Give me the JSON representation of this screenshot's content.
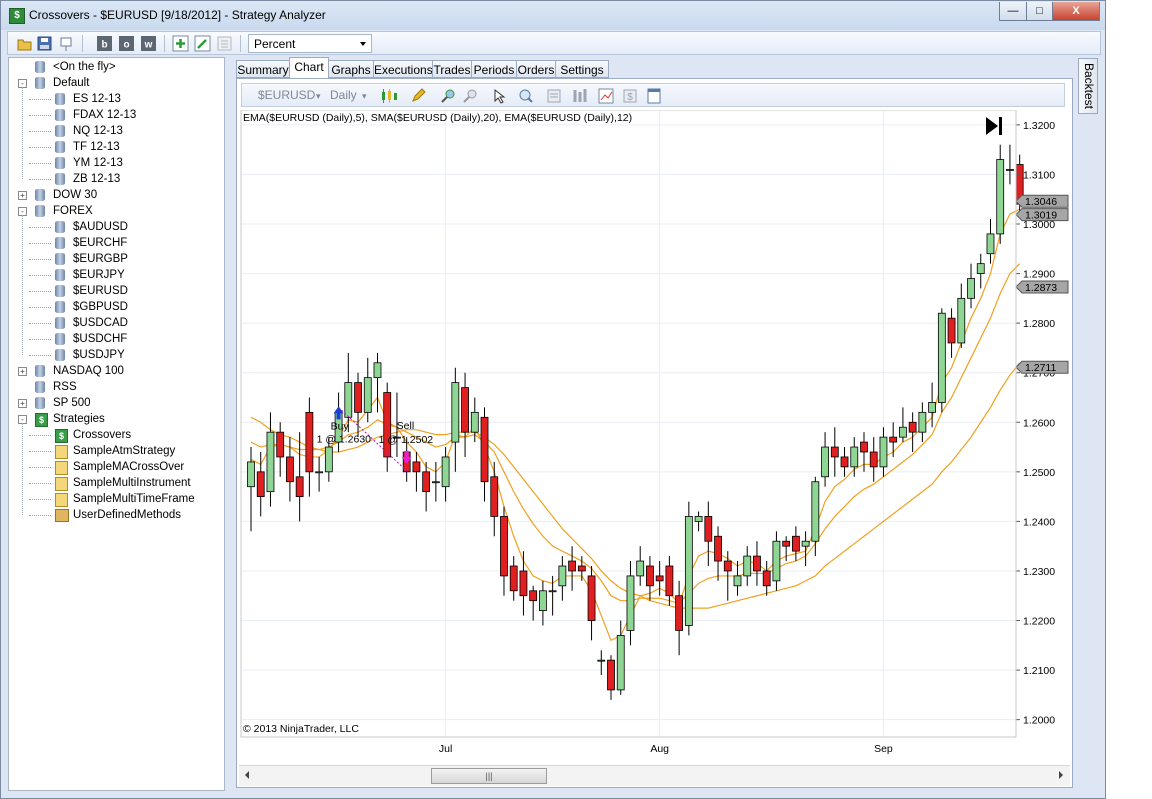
{
  "window": {
    "title": "Crossovers - $EURUSD [9/18/2012] - Strategy Analyzer",
    "icon": "dollar-icon",
    "minimize_label": "—",
    "maximize_label": "□",
    "close_label": "X"
  },
  "toolbar": {
    "icons": [
      "open-folder-icon",
      "save-icon",
      "properties-icon",
      "b-icon",
      "o-icon",
      "w-icon",
      "add-icon",
      "edit-icon",
      "delete-icon"
    ],
    "display_mode": "Percent"
  },
  "tree": {
    "nodes": [
      {
        "label": "<On the fly>",
        "type": "db",
        "level": 0,
        "expander": ""
      },
      {
        "label": "Default",
        "type": "db",
        "level": 0,
        "expander": "-"
      },
      {
        "label": "ES 12-13",
        "type": "db",
        "level": 1,
        "expander": ""
      },
      {
        "label": "FDAX 12-13",
        "type": "db",
        "level": 1,
        "expander": ""
      },
      {
        "label": "NQ 12-13",
        "type": "db",
        "level": 1,
        "expander": ""
      },
      {
        "label": "TF 12-13",
        "type": "db",
        "level": 1,
        "expander": ""
      },
      {
        "label": "YM 12-13",
        "type": "db",
        "level": 1,
        "expander": ""
      },
      {
        "label": "ZB 12-13",
        "type": "db",
        "level": 1,
        "expander": ""
      },
      {
        "label": "DOW 30",
        "type": "db",
        "level": 0,
        "expander": "+"
      },
      {
        "label": "FOREX",
        "type": "db",
        "level": 0,
        "expander": "-"
      },
      {
        "label": "$AUDUSD",
        "type": "db",
        "level": 1,
        "expander": ""
      },
      {
        "label": "$EURCHF",
        "type": "db",
        "level": 1,
        "expander": ""
      },
      {
        "label": "$EURGBP",
        "type": "db",
        "level": 1,
        "expander": ""
      },
      {
        "label": "$EURJPY",
        "type": "db",
        "level": 1,
        "expander": ""
      },
      {
        "label": "$EURUSD",
        "type": "db",
        "level": 1,
        "expander": ""
      },
      {
        "label": "$GBPUSD",
        "type": "db",
        "level": 1,
        "expander": ""
      },
      {
        "label": "$USDCAD",
        "type": "db",
        "level": 1,
        "expander": ""
      },
      {
        "label": "$USDCHF",
        "type": "db",
        "level": 1,
        "expander": ""
      },
      {
        "label": "$USDJPY",
        "type": "db",
        "level": 1,
        "expander": ""
      },
      {
        "label": "NASDAQ 100",
        "type": "db",
        "level": 0,
        "expander": "+"
      },
      {
        "label": "RSS",
        "type": "db",
        "level": 0,
        "expander": ""
      },
      {
        "label": "SP 500",
        "type": "db",
        "level": 0,
        "expander": "+"
      },
      {
        "label": "Strategies",
        "type": "strat",
        "level": 0,
        "expander": "-"
      },
      {
        "label": "Crossovers",
        "type": "strat",
        "level": 1,
        "expander": ""
      },
      {
        "label": "SampleAtmStrategy",
        "type": "doc",
        "level": 1,
        "expander": ""
      },
      {
        "label": "SampleMACrossOver",
        "type": "doc",
        "level": 1,
        "expander": ""
      },
      {
        "label": "SampleMultiInstrument",
        "type": "doc",
        "level": 1,
        "expander": ""
      },
      {
        "label": "SampleMultiTimeFrame",
        "type": "doc",
        "level": 1,
        "expander": ""
      },
      {
        "label": "UserDefinedMethods",
        "type": "box",
        "level": 1,
        "expander": ""
      }
    ]
  },
  "tabs": [
    "Summary",
    "Chart",
    "Graphs",
    "Executions",
    "Trades",
    "Periods",
    "Orders",
    "Settings"
  ],
  "active_tab": "Chart",
  "side_tab": "Backtest",
  "chart_toolbar": {
    "instrument": "$EURUSD",
    "period": "Daily"
  },
  "chart_data": {
    "type": "candlestick",
    "indicator_label": "EMA($EURUSD (Daily),5), SMA($EURUSD (Daily),20), EMA($EURUSD (Daily),12)",
    "copyright": "© 2013 NinjaTrader, LLC",
    "ylim": [
      1.195,
      1.324
    ],
    "y_ticks": [
      1.2,
      1.21,
      1.22,
      1.23,
      1.24,
      1.25,
      1.26,
      1.27,
      1.28,
      1.29,
      1.3,
      1.31,
      1.32
    ],
    "y_tick_labels": [
      "1.2000",
      "1.2100",
      "1.2200",
      "1.2300",
      "1.2400",
      "1.2500",
      "1.2600",
      "1.2700",
      "1.2800",
      "1.2900",
      "1.3000",
      "1.3100",
      "1.3200"
    ],
    "x_labels": [
      {
        "label": "Jul",
        "index": 20
      },
      {
        "label": "Aug",
        "index": 42
      },
      {
        "label": "Sep",
        "index": 65
      }
    ],
    "price_markers": [
      {
        "value": 1.3046,
        "label": "1.3046"
      },
      {
        "value": 1.3019,
        "label": "1.3019"
      },
      {
        "value": 1.2873,
        "label": "1.2873"
      },
      {
        "value": 1.2711,
        "label": "1.2711"
      }
    ],
    "candles": [
      [
        1.247,
        1.252,
        1.238,
        1.255
      ],
      [
        1.25,
        1.245,
        1.241,
        1.254
      ],
      [
        1.246,
        1.258,
        1.243,
        1.262
      ],
      [
        1.258,
        1.253,
        1.249,
        1.26
      ],
      [
        1.253,
        1.248,
        1.244,
        1.257
      ],
      [
        1.249,
        1.245,
        1.24,
        1.258
      ],
      [
        1.262,
        1.25,
        1.245,
        1.265
      ],
      [
        1.25,
        1.25,
        1.246,
        1.253
      ],
      [
        1.25,
        1.255,
        1.248,
        1.257
      ],
      [
        1.256,
        1.262,
        1.254,
        1.266
      ],
      [
        1.261,
        1.268,
        1.258,
        1.274
      ],
      [
        1.268,
        1.262,
        1.257,
        1.27
      ],
      [
        1.262,
        1.269,
        1.26,
        1.273
      ],
      [
        1.269,
        1.272,
        1.262,
        1.274
      ],
      [
        1.266,
        1.253,
        1.25,
        1.268
      ],
      [
        1.257,
        1.257,
        1.253,
        1.266
      ],
      [
        1.254,
        1.25,
        1.248,
        1.257
      ],
      [
        1.252,
        1.25,
        1.246,
        1.254
      ],
      [
        1.25,
        1.246,
        1.242,
        1.252
      ],
      [
        1.248,
        1.248,
        1.244,
        1.252
      ],
      [
        1.247,
        1.253,
        1.244,
        1.255
      ],
      [
        1.256,
        1.268,
        1.25,
        1.271
      ],
      [
        1.267,
        1.258,
        1.253,
        1.27
      ],
      [
        1.258,
        1.262,
        1.256,
        1.265
      ],
      [
        1.261,
        1.248,
        1.244,
        1.263
      ],
      [
        1.249,
        1.241,
        1.237,
        1.252
      ],
      [
        1.241,
        1.229,
        1.225,
        1.243
      ],
      [
        1.231,
        1.226,
        1.224,
        1.233
      ],
      [
        1.23,
        1.225,
        1.221,
        1.234
      ],
      [
        1.226,
        1.224,
        1.22,
        1.227
      ],
      [
        1.222,
        1.226,
        1.219,
        1.228
      ],
      [
        1.226,
        1.226,
        1.221,
        1.229
      ],
      [
        1.227,
        1.231,
        1.224,
        1.233
      ],
      [
        1.232,
        1.23,
        1.226,
        1.235
      ],
      [
        1.231,
        1.23,
        1.228,
        1.233
      ],
      [
        1.229,
        1.22,
        1.216,
        1.231
      ],
      [
        1.212,
        1.212,
        1.209,
        1.214
      ],
      [
        1.212,
        1.206,
        1.204,
        1.213
      ],
      [
        1.206,
        1.217,
        1.205,
        1.22
      ],
      [
        1.218,
        1.229,
        1.215,
        1.232
      ],
      [
        1.229,
        1.232,
        1.227,
        1.235
      ],
      [
        1.231,
        1.227,
        1.224,
        1.233
      ],
      [
        1.229,
        1.228,
        1.225,
        1.232
      ],
      [
        1.231,
        1.225,
        1.223,
        1.233
      ],
      [
        1.225,
        1.218,
        1.213,
        1.228
      ],
      [
        1.219,
        1.241,
        1.217,
        1.244
      ],
      [
        1.24,
        1.241,
        1.238,
        1.242
      ],
      [
        1.241,
        1.236,
        1.231,
        1.244
      ],
      [
        1.237,
        1.232,
        1.228,
        1.239
      ],
      [
        1.232,
        1.23,
        1.224,
        1.234
      ],
      [
        1.227,
        1.229,
        1.225,
        1.232
      ],
      [
        1.229,
        1.233,
        1.227,
        1.235
      ],
      [
        1.233,
        1.23,
        1.227,
        1.236
      ],
      [
        1.23,
        1.227,
        1.225,
        1.232
      ],
      [
        1.228,
        1.236,
        1.226,
        1.238
      ],
      [
        1.236,
        1.235,
        1.232,
        1.237
      ],
      [
        1.237,
        1.234,
        1.232,
        1.239
      ],
      [
        1.235,
        1.236,
        1.231,
        1.238
      ],
      [
        1.236,
        1.248,
        1.233,
        1.249
      ],
      [
        1.249,
        1.255,
        1.247,
        1.258
      ],
      [
        1.255,
        1.253,
        1.249,
        1.259
      ],
      [
        1.253,
        1.251,
        1.249,
        1.255
      ],
      [
        1.251,
        1.255,
        1.249,
        1.257
      ],
      [
        1.256,
        1.254,
        1.25,
        1.258
      ],
      [
        1.254,
        1.251,
        1.248,
        1.257
      ],
      [
        1.251,
        1.257,
        1.249,
        1.259
      ],
      [
        1.257,
        1.256,
        1.253,
        1.26
      ],
      [
        1.257,
        1.259,
        1.256,
        1.263
      ],
      [
        1.26,
        1.258,
        1.254,
        1.262
      ],
      [
        1.258,
        1.262,
        1.256,
        1.264
      ],
      [
        1.262,
        1.264,
        1.259,
        1.268
      ],
      [
        1.264,
        1.282,
        1.262,
        1.283
      ],
      [
        1.281,
        1.276,
        1.273,
        1.283
      ],
      [
        1.276,
        1.285,
        1.275,
        1.288
      ],
      [
        1.285,
        1.289,
        1.283,
        1.292
      ],
      [
        1.29,
        1.292,
        1.287,
        1.294
      ],
      [
        1.294,
        1.298,
        1.292,
        1.301
      ],
      [
        1.298,
        1.313,
        1.296,
        1.316
      ],
      [
        1.311,
        1.311,
        1.308,
        1.316
      ],
      [
        1.312,
        1.304,
        1.302,
        1.314
      ]
    ],
    "ema5": [
      1.2525,
      1.2515,
      1.255,
      1.2555,
      1.255,
      1.2535,
      1.253,
      1.253,
      1.2545,
      1.257,
      1.2605,
      1.26,
      1.2625,
      1.265,
      1.26,
      1.259,
      1.256,
      1.254,
      1.251,
      1.25,
      1.252,
      1.2575,
      1.257,
      1.259,
      1.255,
      1.25,
      1.243,
      1.237,
      1.232,
      1.229,
      1.228,
      1.2275,
      1.229,
      1.229,
      1.229,
      1.226,
      1.221,
      1.216,
      1.217,
      1.221,
      1.225,
      1.2255,
      1.2265,
      1.2255,
      1.2235,
      1.229,
      1.233,
      1.234,
      1.2335,
      1.2325,
      1.231,
      1.232,
      1.2315,
      1.23,
      1.232,
      1.233,
      1.2335,
      1.234,
      1.2385,
      1.244,
      1.247,
      1.2485,
      1.2505,
      1.2515,
      1.2515,
      1.253,
      1.254,
      1.256,
      1.257,
      1.259,
      1.261,
      1.268,
      1.271,
      1.276,
      1.281,
      1.285,
      1.29,
      1.298,
      1.302,
      1.303
    ],
    "sma20": [
      1.261,
      1.26,
      1.2585,
      1.2575,
      1.257,
      1.256,
      1.255,
      1.2545,
      1.254,
      1.254,
      1.2545,
      1.255,
      1.256,
      1.257,
      1.2575,
      1.258,
      1.2585,
      1.2585,
      1.258,
      1.2575,
      1.2575,
      1.258,
      1.258,
      1.258,
      1.257,
      1.2555,
      1.2535,
      1.251,
      1.2485,
      1.246,
      1.2435,
      1.241,
      1.2385,
      1.2365,
      1.2345,
      1.2325,
      1.23,
      1.228,
      1.2265,
      1.2255,
      1.225,
      1.224,
      1.2235,
      1.223,
      1.2225,
      1.2225,
      1.2225,
      1.2225,
      1.223,
      1.2235,
      1.224,
      1.2245,
      1.225,
      1.2255,
      1.226,
      1.2265,
      1.227,
      1.228,
      1.229,
      1.231,
      1.2325,
      1.234,
      1.2355,
      1.237,
      1.2385,
      1.24,
      1.2415,
      1.243,
      1.2445,
      1.246,
      1.2475,
      1.25,
      1.252,
      1.2545,
      1.257,
      1.26,
      1.263,
      1.2665,
      1.2695,
      1.272
    ],
    "ema12": [
      1.256,
      1.255,
      1.2555,
      1.2555,
      1.255,
      1.2545,
      1.2545,
      1.2545,
      1.255,
      1.256,
      1.2575,
      1.258,
      1.259,
      1.2605,
      1.2595,
      1.259,
      1.258,
      1.257,
      1.256,
      1.255,
      1.2555,
      1.257,
      1.257,
      1.2575,
      1.256,
      1.254,
      1.25,
      1.246,
      1.2425,
      1.2395,
      1.237,
      1.235,
      1.234,
      1.233,
      1.232,
      1.2305,
      1.228,
      1.225,
      1.224,
      1.224,
      1.2245,
      1.2245,
      1.2245,
      1.224,
      1.2235,
      1.2255,
      1.2275,
      1.2285,
      1.229,
      1.229,
      1.229,
      1.2295,
      1.2295,
      1.2295,
      1.2305,
      1.2315,
      1.232,
      1.233,
      1.2355,
      1.2385,
      1.241,
      1.243,
      1.245,
      1.2465,
      1.2475,
      1.249,
      1.2505,
      1.252,
      1.2535,
      1.2555,
      1.2575,
      1.262,
      1.265,
      1.269,
      1.273,
      1.277,
      1.281,
      1.286,
      1.29,
      1.292
    ],
    "trades": [
      {
        "type": "buy",
        "index": 9,
        "price": 1.263,
        "label": "Buy",
        "detail": "1 @ 1.2630"
      },
      {
        "type": "sell",
        "index": 16,
        "price": 1.2502,
        "label": "Sell",
        "detail": "1 @ 1.2502"
      }
    ],
    "colors": {
      "up": "#8fd694",
      "down": "#e02020",
      "ema5": "#f1a020",
      "sma20": "#f1a020",
      "ema12": "#f1a020",
      "grid": "#e9eef5",
      "trade_line": "#cc00cc"
    }
  }
}
